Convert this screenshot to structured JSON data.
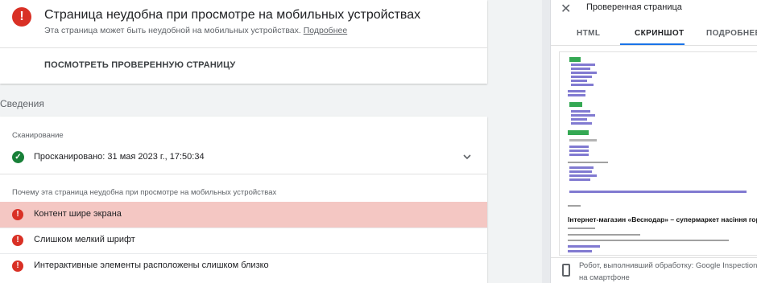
{
  "summary": {
    "title": "Страница неудобна при просмотре на мобильных устройствах",
    "subtitle": "Эта страница может быть неудобной на мобильных устройствах.",
    "more_link": "Подробнее",
    "view_button": "ПОСМОТРЕТЬ ПРОВЕРЕННУЮ СТРАНИЦУ"
  },
  "details": {
    "section_label": "Сведения",
    "scan_label": "Сканирование",
    "scan_value": "Просканировано: 31 мая 2023 г., 17:50:34",
    "why_label": "Почему эта страница неудобна при просмотре на мобильных устройствах",
    "issues": [
      {
        "text": "Контент шире экрана",
        "highlighted": true
      },
      {
        "text": "Слишком мелкий шрифт",
        "highlighted": false
      },
      {
        "text": "Интерактивные элементы расположены слишком близко",
        "highlighted": false
      }
    ]
  },
  "panel": {
    "title": "Проверенная страница",
    "tabs": [
      "HTML",
      "СКРИНШОТ",
      "ПОДРОБНЕЕ"
    ],
    "active_tab": "СКРИНШОТ",
    "screenshot_heading": "Інтернет-магазин «Веснодар» – супермаркет насіння город",
    "robot_line1": "Робот, выполнивший обработку: Google Inspection Tool",
    "robot_line2": "на смартфоне"
  },
  "colors": {
    "error": "#d93025",
    "success": "#188038",
    "highlight": "#f4c7c3",
    "accent": "#1a73e8"
  },
  "icons": [
    "error-icon",
    "check-icon",
    "chevron-down-icon",
    "close-icon",
    "phone-icon"
  ]
}
